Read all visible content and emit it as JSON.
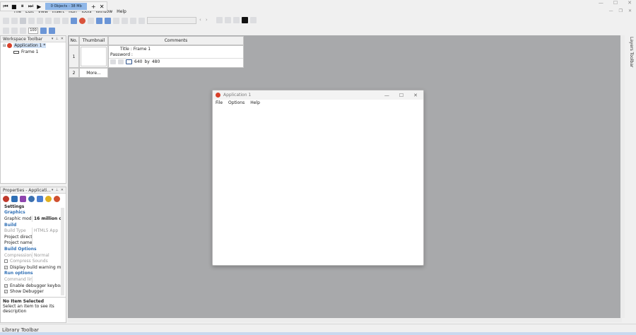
{
  "debugger": {
    "status_text": "0 Objects - 38 Mb"
  },
  "menubar": {
    "items": [
      "File",
      "Edit",
      "View",
      "Insert",
      "Run",
      "Tools",
      "Window",
      "Help"
    ]
  },
  "toolbar": {
    "zoom_value": "100"
  },
  "workspace": {
    "title": "Workspace Toolbar",
    "tree": {
      "app_label": "Application 1 *",
      "frame_label": "Frame 1"
    }
  },
  "frame_grid": {
    "headers": [
      "No.",
      "Thumbnail",
      "Comments"
    ],
    "row1": {
      "no": "1",
      "title": "Title : Frame 1",
      "password": "Password :",
      "width": "640",
      "by": "by",
      "height": "480"
    },
    "row2": {
      "no": "2",
      "more": "More..."
    }
  },
  "properties": {
    "title": "Properties - Applicati...",
    "rows": [
      {
        "type": "section-dark",
        "label": "Settings"
      },
      {
        "type": "section",
        "label": "Graphics"
      },
      {
        "type": "row",
        "key": "Graphic mode",
        "value": "16 million c"
      },
      {
        "type": "section",
        "label": "Build"
      },
      {
        "type": "row-grey",
        "key": "Build Type",
        "value": "HTML5 App"
      },
      {
        "type": "row",
        "key": "Project director",
        "value": ""
      },
      {
        "type": "row",
        "key": "Project name",
        "value": ""
      },
      {
        "type": "section",
        "label": "Build Options"
      },
      {
        "type": "row-grey",
        "key": "Compression le",
        "value": "Normal"
      },
      {
        "type": "check-grey",
        "key": "Compress Sounds"
      },
      {
        "type": "check",
        "key": "Display build warning me"
      },
      {
        "type": "section",
        "label": "Run options"
      },
      {
        "type": "row-grey",
        "key": "Command line",
        "value": ""
      },
      {
        "type": "check",
        "key": "Enable debugger keyboa"
      },
      {
        "type": "check",
        "key": "Show Debugger"
      }
    ],
    "desc_title": "No Item Selected",
    "desc_text": "Select an item to see its description"
  },
  "app_window": {
    "title": "Application 1",
    "menu": [
      "File",
      "Options",
      "Help"
    ]
  },
  "layers_toolbar": "Layers Toolbar",
  "status": {
    "library": "Library Toolbar"
  },
  "colors": {
    "accent_blue": "#2f6fb5",
    "editor_bg": "#a8a9ab",
    "debug_blue": "#8fb7e8"
  }
}
